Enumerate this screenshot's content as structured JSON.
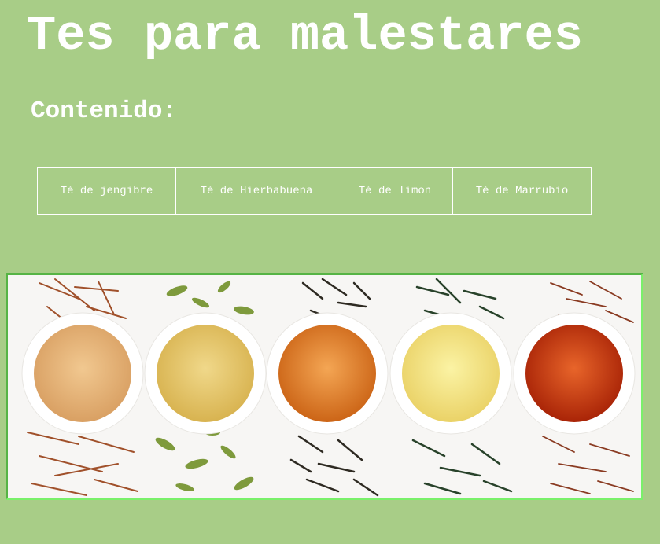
{
  "page": {
    "title": "Tes para malestares",
    "contents_heading": "Contenido:"
  },
  "nav": {
    "items": [
      {
        "label": "Té de jengibre"
      },
      {
        "label": "Té de Hierbabuena"
      },
      {
        "label": "Té de limon"
      },
      {
        "label": "Té de Marrubio"
      }
    ]
  },
  "colors": {
    "background": "#a8cd87",
    "text": "#ffffff",
    "image_border": "#56b445"
  },
  "hero_image": {
    "subject": "five cups of tea with loose leaves"
  }
}
